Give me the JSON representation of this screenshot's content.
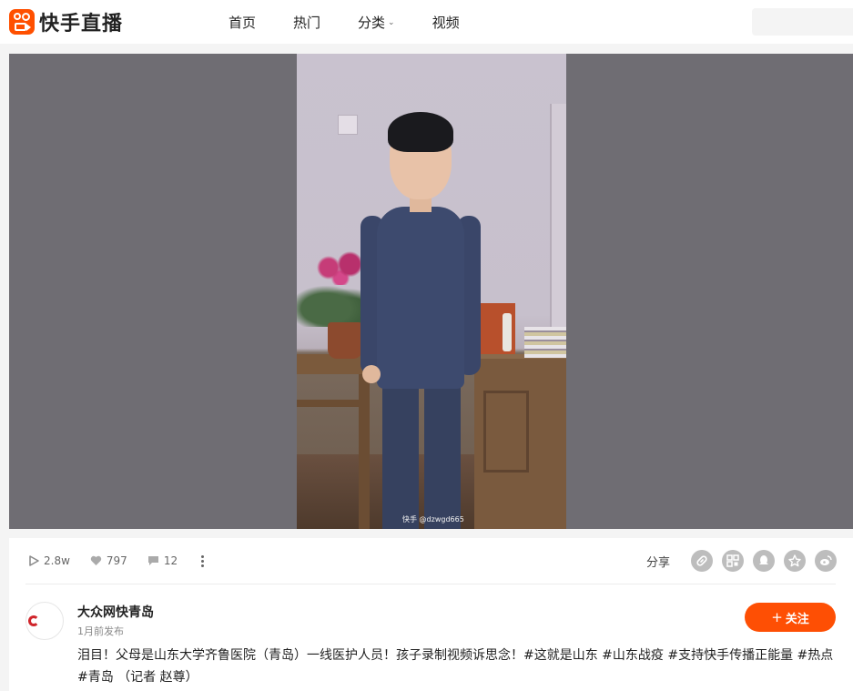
{
  "header": {
    "logo_text": "快手直播",
    "nav": [
      "首页",
      "热门",
      "分类",
      "视频"
    ]
  },
  "video": {
    "watermark": "快手 @dzwgd665"
  },
  "stats": {
    "plays": "2.8w",
    "likes": "797",
    "comments": "12"
  },
  "share": {
    "label": "分享",
    "icons": [
      "link-icon",
      "qrcode-icon",
      "qq-icon",
      "qzone-icon",
      "weibo-icon"
    ]
  },
  "author": {
    "name": "大众网快青岛",
    "time": "1月前发布",
    "follow_label": "关注"
  },
  "caption": "泪目！父母是山东大学齐鲁医院（青岛）一线医护人员！孩子录制视频诉思念！#这就是山东 #山东战疫 #支持快手传播正能量 #热点 #青岛 （记者 赵尊）",
  "colors": {
    "accent": "#fe4f04",
    "logo": "#ff5000"
  }
}
